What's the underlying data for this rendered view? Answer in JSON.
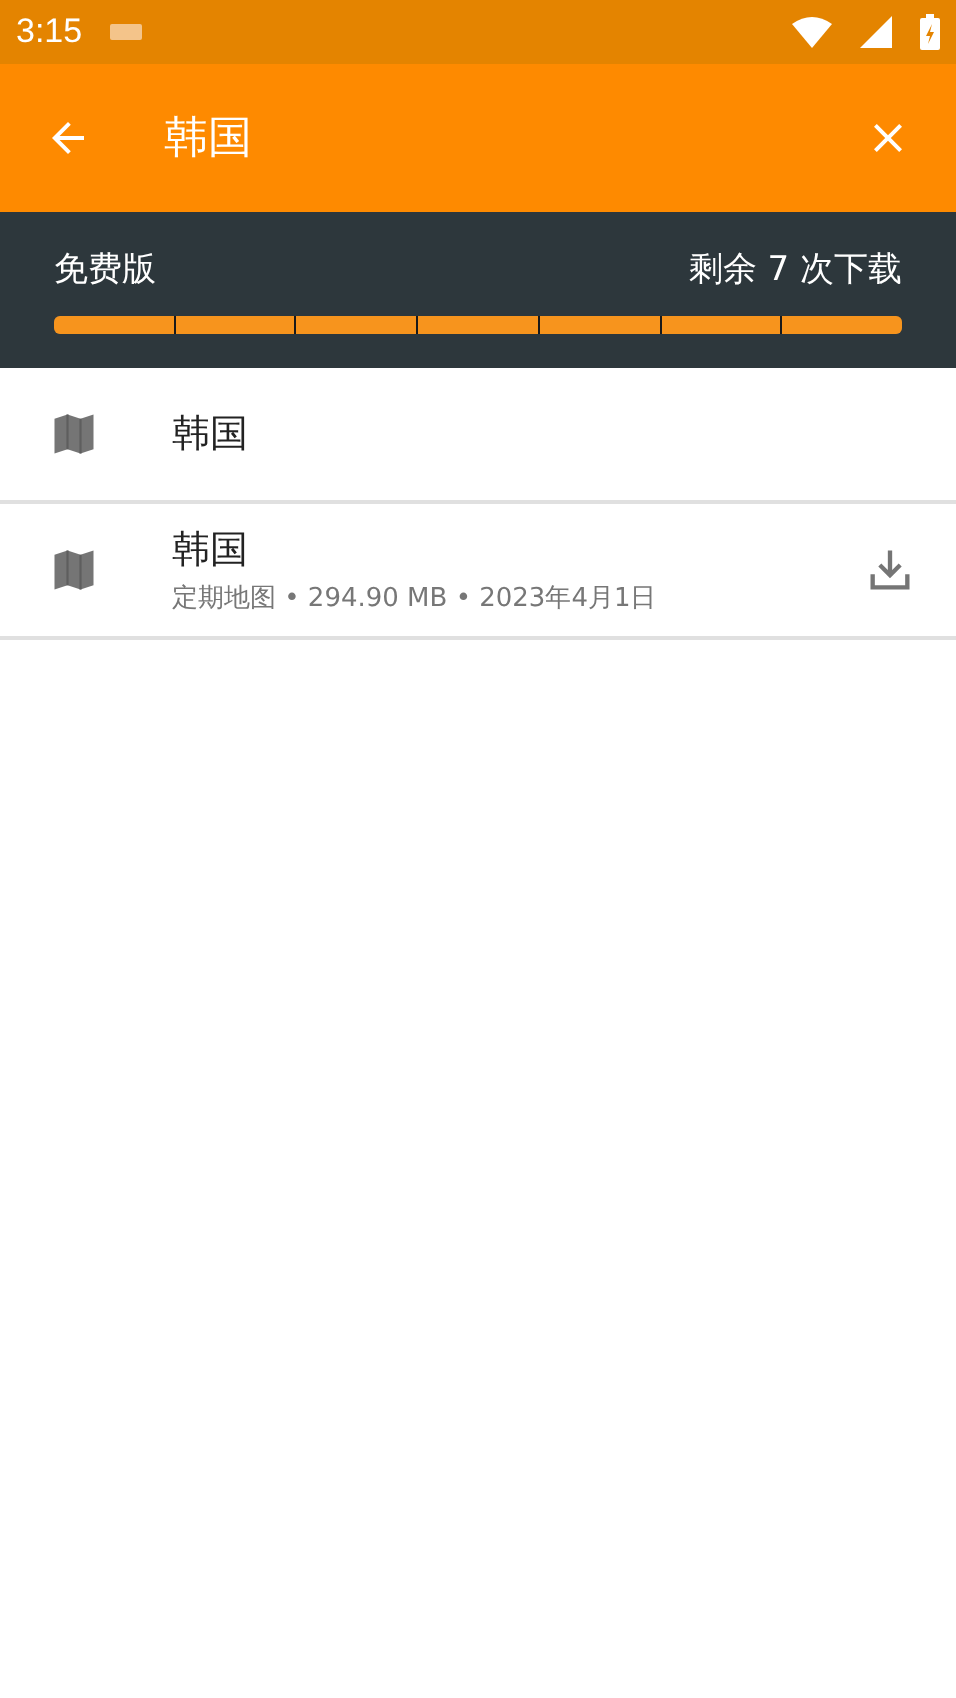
{
  "status_bar": {
    "time": "3:15"
  },
  "toolbar": {
    "title": "韩国"
  },
  "plan": {
    "label": "免费版",
    "remaining": "剩余 7 次下载",
    "segments": [
      {
        "filled": true
      },
      {
        "filled": true
      },
      {
        "filled": true
      },
      {
        "filled": true
      },
      {
        "filled": true
      },
      {
        "filled": true
      },
      {
        "filled": true
      }
    ]
  },
  "items": [
    {
      "title": "韩国",
      "downloadable": false
    },
    {
      "title": "韩国",
      "subtitle": "定期地图 • 294.90 MB • 2023年4月1日",
      "downloadable": true
    }
  ]
}
